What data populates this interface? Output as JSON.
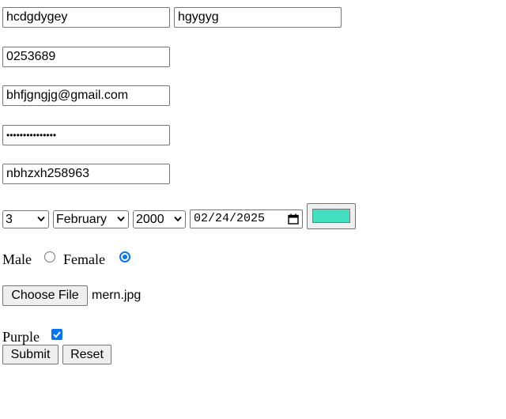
{
  "form": {
    "first_name": {
      "value": "hcdgdygey"
    },
    "last_name": {
      "value": "hgygyg"
    },
    "phone": {
      "value": "0253689"
    },
    "email": {
      "value": "bhfjgngjg@gmail.com"
    },
    "password": {
      "value": "•••••••••••••••"
    },
    "username": {
      "value": "nbhzxh258963"
    },
    "day_select": {
      "selected": "3"
    },
    "month_select": {
      "selected": "February"
    },
    "year_select": {
      "selected": "2000"
    },
    "date_input": {
      "value": "02/24/2025"
    },
    "color_input": {
      "value": "#40e0c0"
    },
    "gender": {
      "male_label": "Male",
      "female_label": "Female",
      "selected": "Female"
    },
    "file": {
      "button_label": "Choose File",
      "filename": "mern.jpg"
    },
    "color_choice": {
      "label": "Purple",
      "checked": true
    },
    "buttons": {
      "submit_label": "Submit",
      "reset_label": "Reset"
    }
  },
  "icons": {
    "select_arrow": "chevron-down-icon",
    "date_picker": "calendar-icon",
    "checkbox_mark": "checkmark-icon"
  },
  "colors": {
    "accent": "#0075ff",
    "swatch": "#40e0c0",
    "border": "#767676",
    "button_bg": "#efefef"
  }
}
